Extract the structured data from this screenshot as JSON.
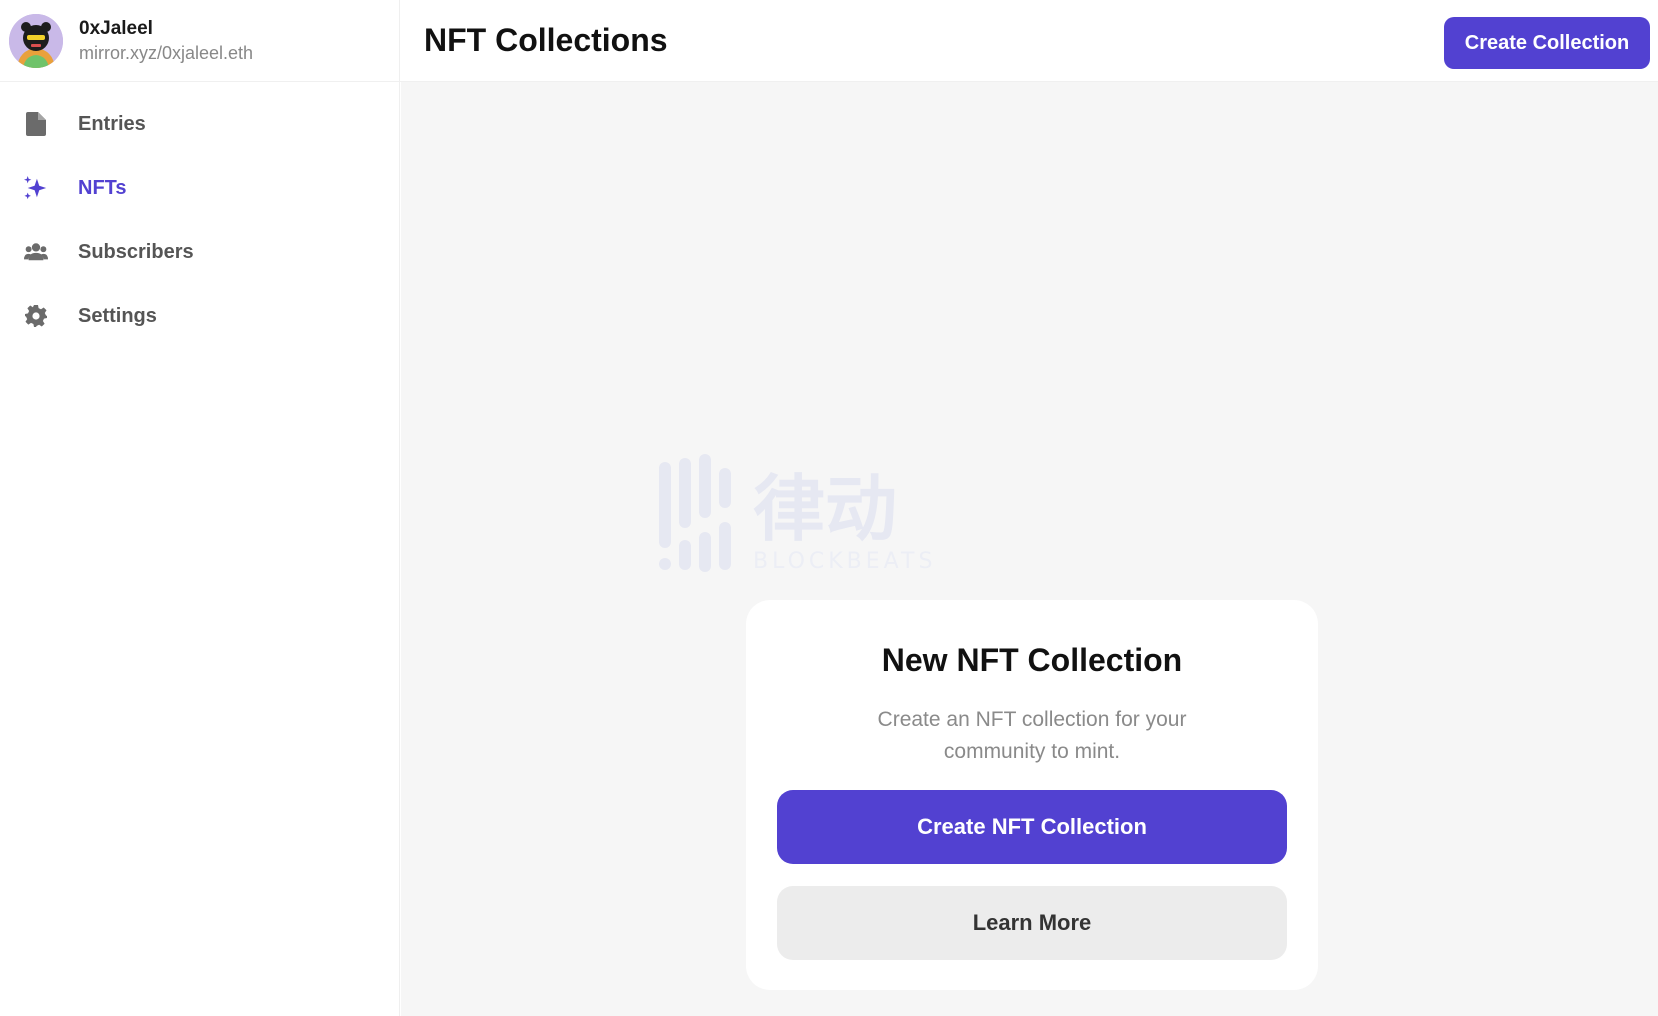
{
  "profile": {
    "name": "0xJaleel",
    "url": "mirror.xyz/0xjaleel.eth"
  },
  "sidebar": {
    "items": [
      {
        "label": "Entries",
        "icon": "document-icon",
        "active": false
      },
      {
        "label": "NFTs",
        "icon": "sparkles-icon",
        "active": true
      },
      {
        "label": "Subscribers",
        "icon": "users-icon",
        "active": false
      },
      {
        "label": "Settings",
        "icon": "gear-icon",
        "active": false
      }
    ]
  },
  "header": {
    "title": "NFT Collections",
    "create_button": "Create Collection"
  },
  "card": {
    "title": "New NFT Collection",
    "description": "Create an NFT collection for your community to mint.",
    "primary_button": "Create NFT Collection",
    "secondary_button": "Learn More"
  },
  "watermark": {
    "text_main": "律动",
    "text_sub": "BLOCKBEATS"
  },
  "colors": {
    "accent": "#5241d1",
    "muted_text": "#888888",
    "background": "#f6f6f6"
  }
}
